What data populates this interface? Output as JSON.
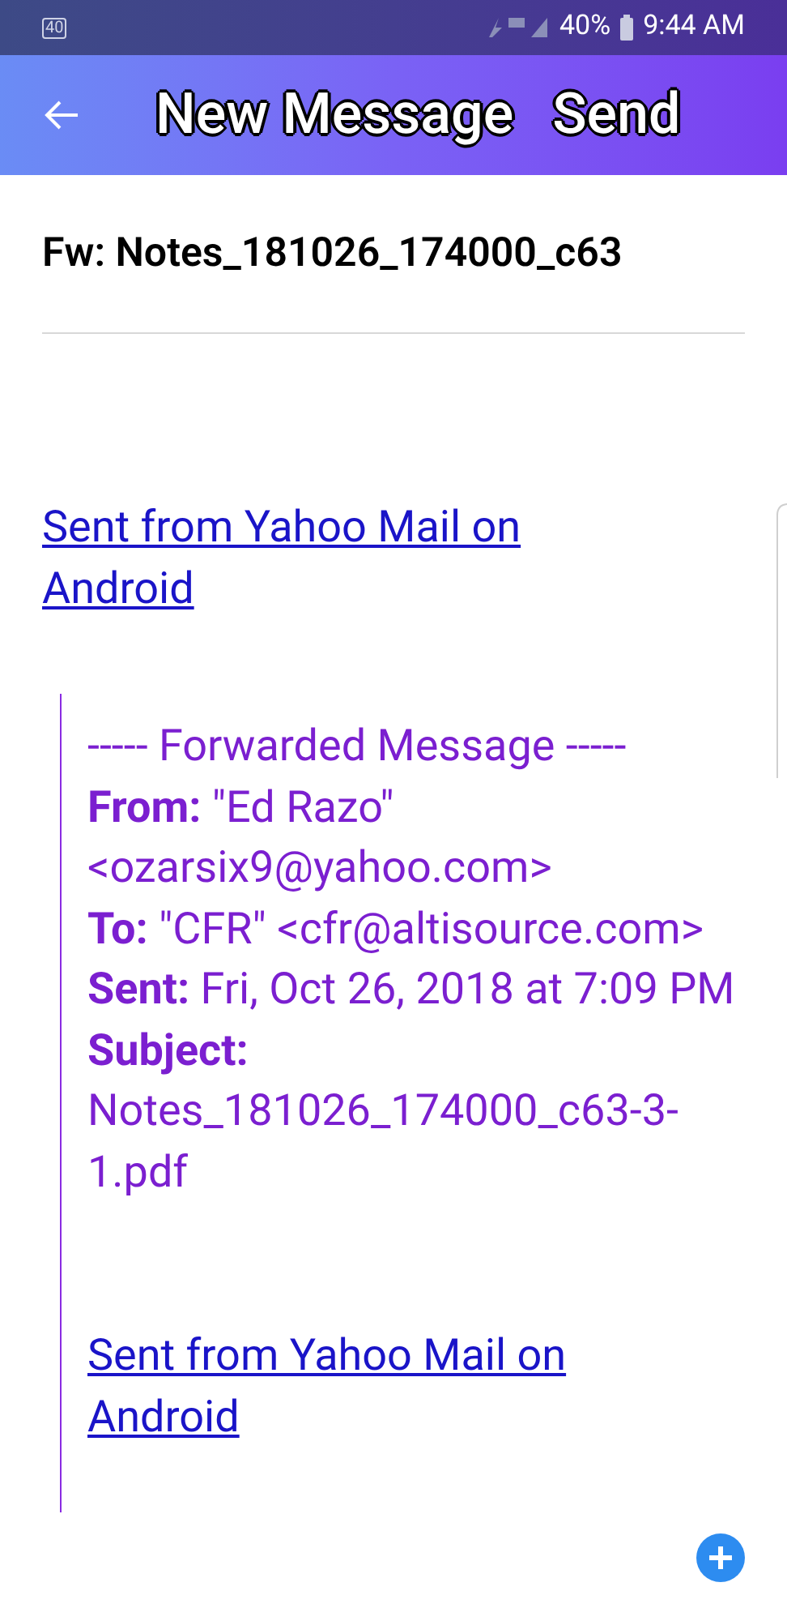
{
  "status_bar": {
    "badge": "40",
    "battery": "40%",
    "time": "9:44 AM"
  },
  "app_bar": {
    "title": "New Message",
    "action": "Send"
  },
  "subject": "Fw: Notes_181026_174000_c63",
  "signature": "Sent from Yahoo Mail on Android",
  "forwarded": {
    "header": "----- Forwarded Message -----",
    "fields": [
      {
        "text": "**From:** \"Ed Razo\" <ozarsix9@yahoo.com>"
      },
      {
        "text": "**To:** \"CFR\" <cfr@altisource.com>"
      },
      {
        "text": "**Sent:** Fri, Oct 26, 2018 at 7:09 PM"
      },
      {
        "text": "**Subject:** Notes_181026_174000_c63-3-1.pdf"
      }
    ],
    "signature": "Sent from Yahoo Mail on Android"
  }
}
